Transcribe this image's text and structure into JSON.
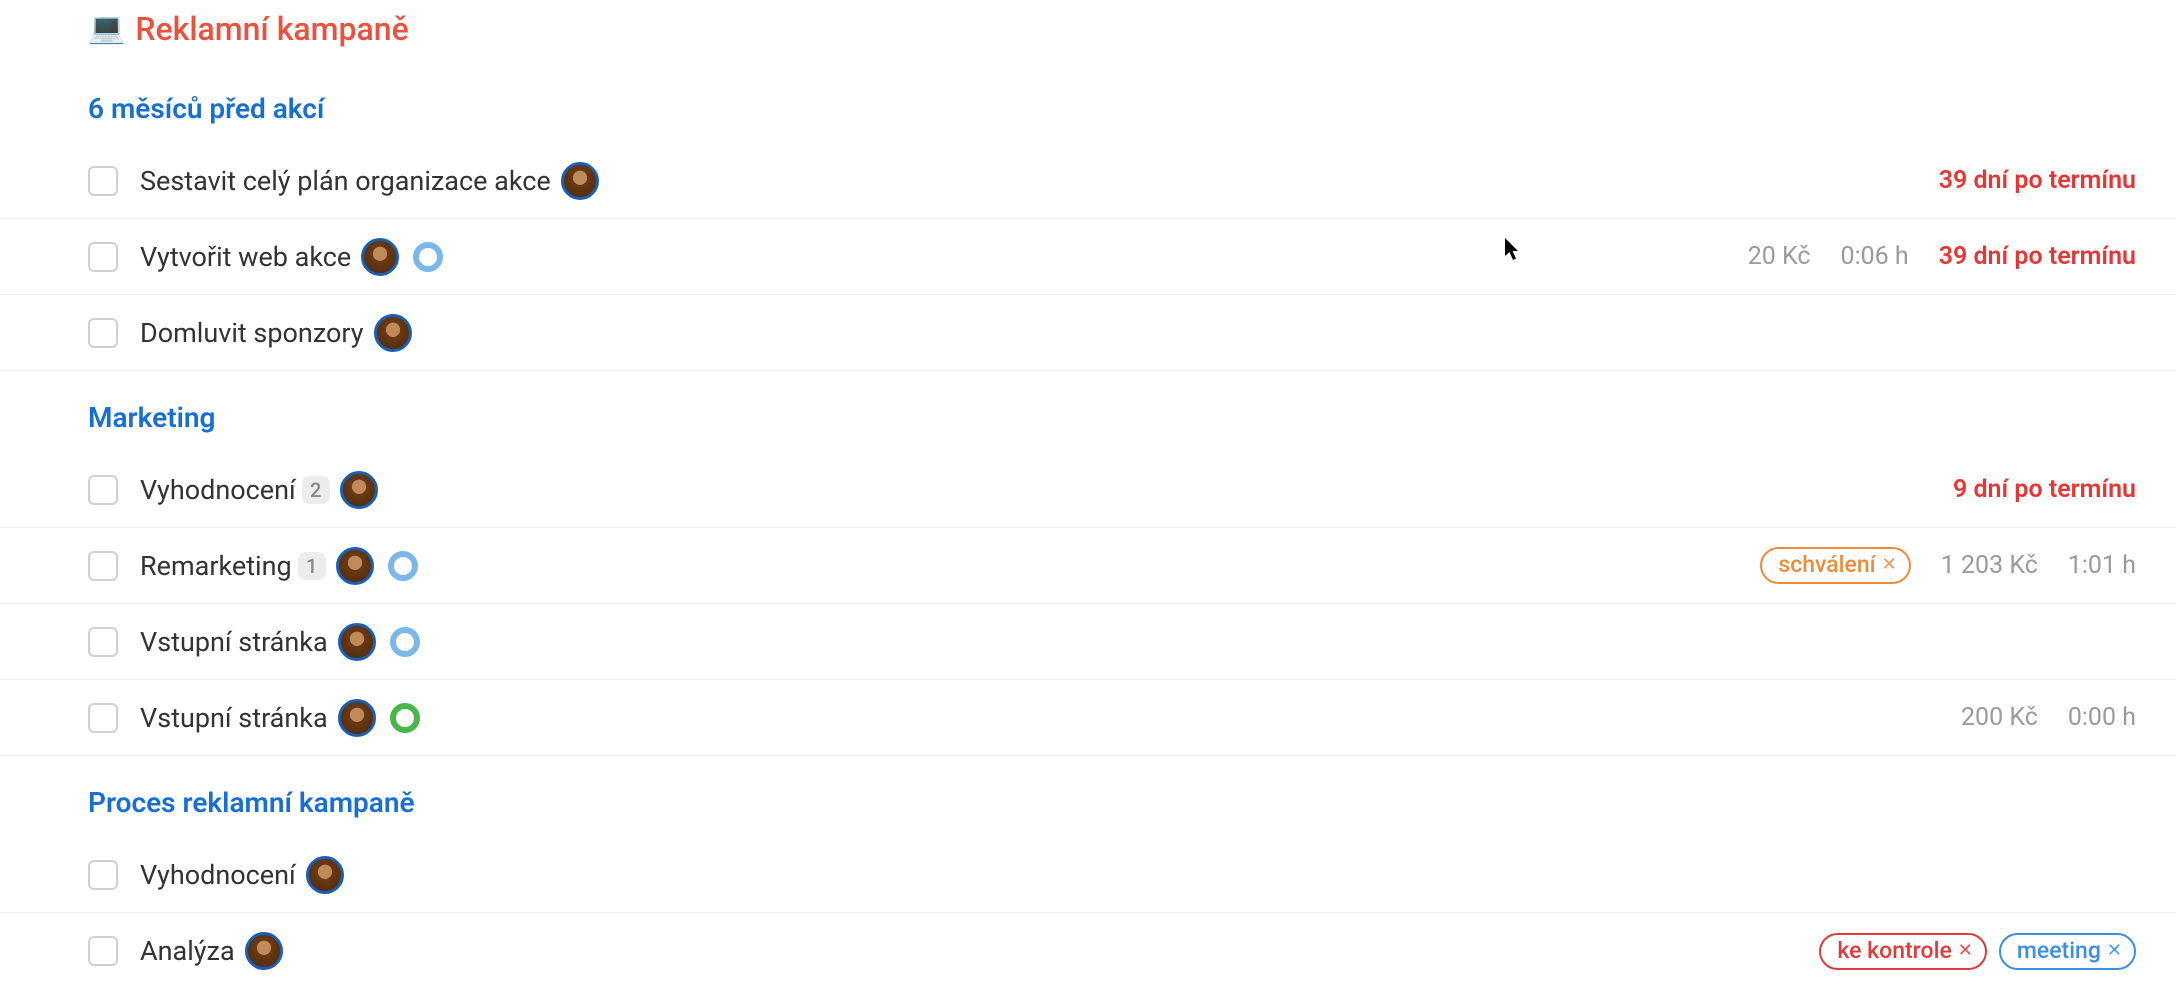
{
  "page": {
    "emoji": "💻",
    "title": "Reklamní kampaně"
  },
  "sections": [
    {
      "title": "6 měsíců před akcí",
      "tasks": [
        {
          "title": "Sestavit celý plán organizace akce",
          "avatar": true,
          "overdue": "39 dní po termínu"
        },
        {
          "title": "Vytvořit web akce",
          "avatar": true,
          "status": "blue",
          "cost": "20 Kč",
          "time": "0:06 h",
          "overdue": "39 dní po termínu"
        },
        {
          "title": "Domluvit sponzory",
          "avatar": true
        }
      ]
    },
    {
      "title": "Marketing",
      "tasks": [
        {
          "title": "Vyhodnocení",
          "count": "2",
          "avatar": true,
          "overdue": "9 dní po termínu"
        },
        {
          "title": "Remarketing",
          "count": "1",
          "avatar": true,
          "status": "blue",
          "tag": {
            "label": "schválení",
            "color": "orange"
          },
          "cost": "1 203 Kč",
          "time": "1:01 h"
        },
        {
          "title": "Vstupní stránka",
          "avatar": true,
          "status": "blue"
        },
        {
          "title": "Vstupní stránka",
          "avatar": true,
          "status": "green",
          "cost": "200 Kč",
          "time": "0:00 h"
        }
      ]
    },
    {
      "title": "Proces reklamní kampaně",
      "tasks": [
        {
          "title": "Vyhodnocení",
          "avatar": true
        },
        {
          "title": "Analýza",
          "avatar": true,
          "tags": [
            {
              "label": "ke kontrole",
              "color": "red"
            },
            {
              "label": "meeting",
              "color": "blue"
            }
          ]
        }
      ]
    }
  ]
}
